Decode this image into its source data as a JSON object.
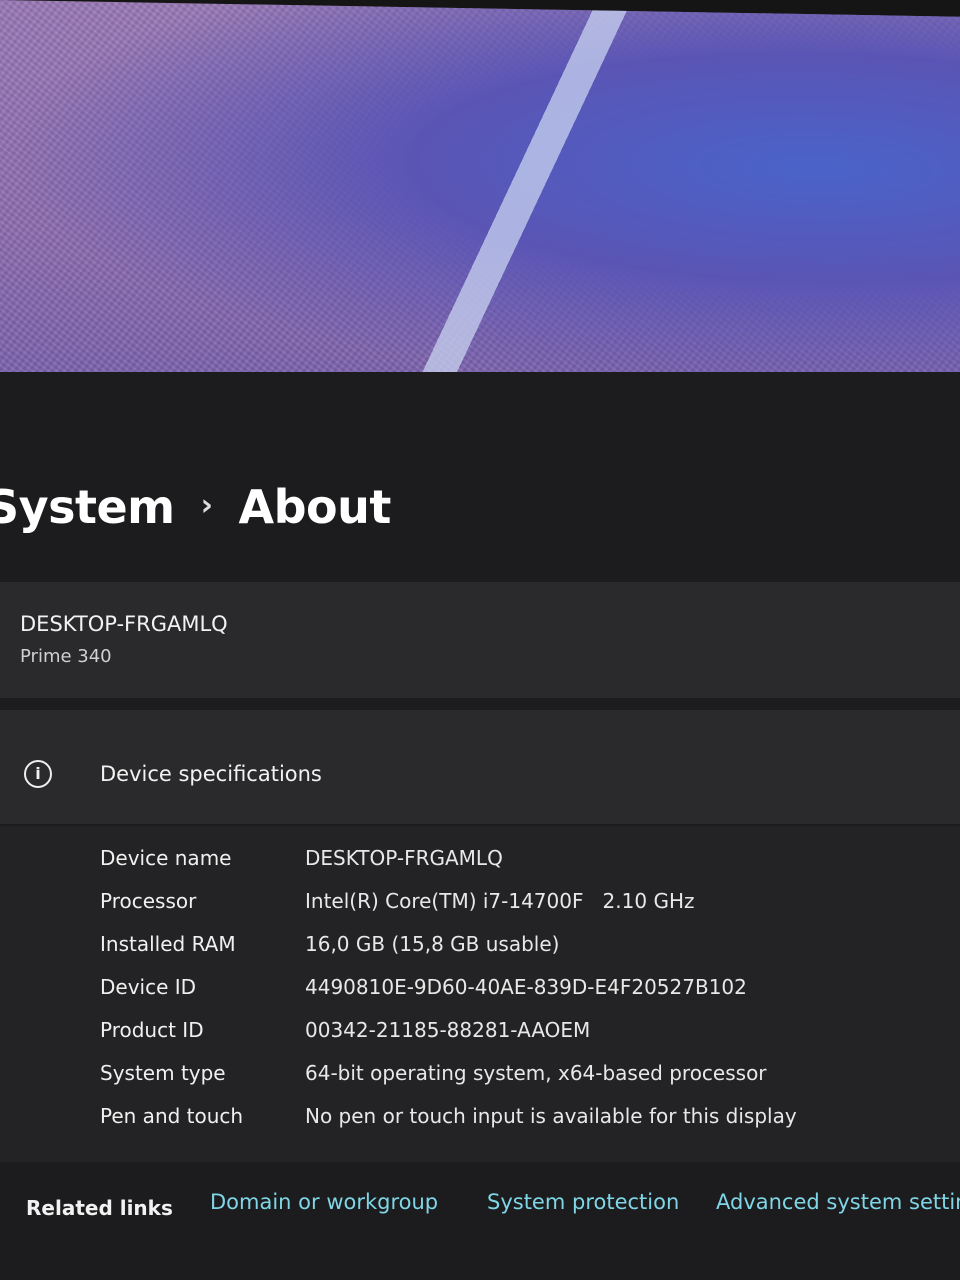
{
  "breadcrumb": {
    "parent": "System",
    "separator": "›",
    "current": "About"
  },
  "device_card": {
    "device_name": "DESKTOP-FRGAMLQ",
    "model": "Prime 340"
  },
  "specs": {
    "header": "Device specifications",
    "icon": "info-icon",
    "rows": [
      {
        "label": "Device name",
        "value": "DESKTOP-FRGAMLQ"
      },
      {
        "label": "Processor",
        "value": "Intel(R) Core(TM) i7-14700F   2.10 GHz"
      },
      {
        "label": "Installed RAM",
        "value": "16,0 GB (15,8 GB usable)"
      },
      {
        "label": "Device ID",
        "value": "4490810E-9D60-40AE-839D-E4F20527B102"
      },
      {
        "label": "Product ID",
        "value": "00342-21185-88281-AAOEM"
      },
      {
        "label": "System type",
        "value": "64-bit operating system, x64-based processor"
      },
      {
        "label": "Pen and touch",
        "value": "No pen or touch input is available for this display"
      }
    ]
  },
  "related_links": {
    "header": "Related links",
    "links": [
      "Domain or workgroup",
      "System protection",
      "Advanced system settings"
    ]
  },
  "colors": {
    "link": "#7fd6e6",
    "background": "#1c1c1e",
    "card": "#2a2a2c"
  }
}
